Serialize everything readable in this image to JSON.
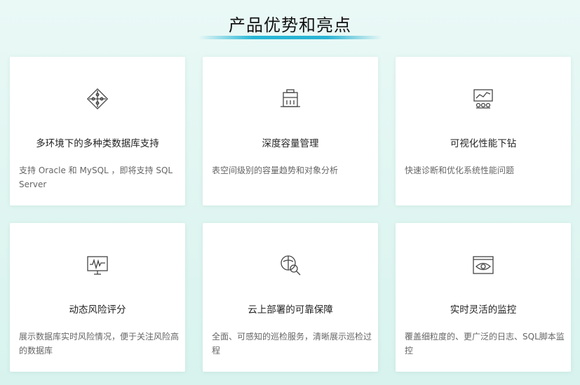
{
  "page": {
    "title": "产品优势和亮点",
    "accent_color": "#27b6d6"
  },
  "cards": [
    {
      "icon": "puzzle-icon",
      "title": "多环境下的多种类数据库支持",
      "desc": "支持 Oracle 和 MySQL ，即将支持 SQL Server"
    },
    {
      "icon": "database-capacity-icon",
      "title": "深度容量管理",
      "desc": "表空间级别的容量趋势和对象分析"
    },
    {
      "icon": "chart-monitor-icon",
      "title": "可视化性能下钻",
      "desc": "快速诊断和优化系统性能问题"
    },
    {
      "icon": "pulse-monitor-icon",
      "title": "动态风险评分",
      "desc": "展示数据库实时风险情况，便于关注风险高的数据库"
    },
    {
      "icon": "inspection-search-icon",
      "title": "云上部署的可靠保障",
      "desc": "全面、可感知的巡检服务，清晰展示巡检过程"
    },
    {
      "icon": "eye-monitor-icon",
      "title": "实时灵活的监控",
      "desc": "覆盖细粒度的、更广泛的日志、SQL脚本监控"
    }
  ]
}
